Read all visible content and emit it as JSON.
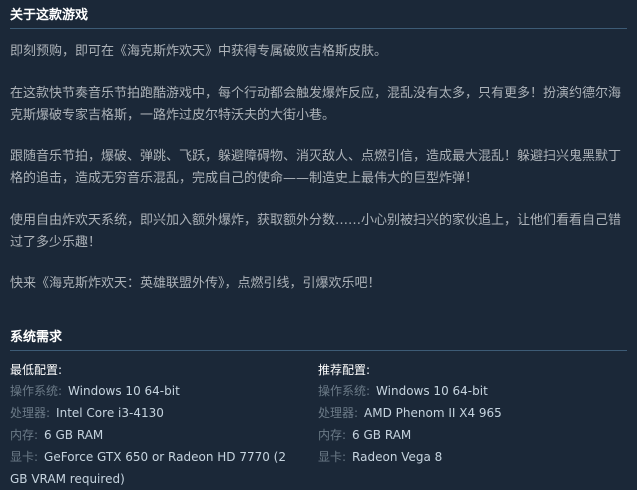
{
  "about": {
    "header": "关于这款游戏",
    "paragraphs": [
      "即刻预购，即可在《海克斯炸欢天》中获得专属破败吉格斯皮肤。",
      "在这款快节奏音乐节拍跑酷游戏中，每个行动都会触发爆炸反应，混乱没有太多，只有更多！扮演约德尔海克斯爆破专家吉格斯，一路炸过皮尔特沃夫的大街小巷。",
      "跟随音乐节拍，爆破、弹跳、飞跃，躲避障碍物、消灭敌人、点燃引信，造成最大混乱！躲避扫兴鬼黑默丁格的追击，造成无穷音乐混乱，完成自己的使命——制造史上最伟大的巨型炸弹！",
      "使用自由炸欢天系统，即兴加入额外爆炸，获取额外分数……小心别被扫兴的家伙追上，让他们看看自己错过了多少乐趣！",
      "快来《海克斯炸欢天：英雄联盟外传》，点燃引线，引爆欢乐吧！"
    ]
  },
  "sysreq": {
    "header": "系统需求",
    "minimum": {
      "title": "最低配置:",
      "rows": [
        {
          "label": "操作系统:",
          "value": "Windows 10 64-bit"
        },
        {
          "label": "处理器:",
          "value": "Intel Core i3-4130"
        },
        {
          "label": "内存:",
          "value": "6 GB RAM"
        },
        {
          "label": "显卡:",
          "value": "GeForce GTX 650 or Radeon HD 7770 (2 GB VRAM required)"
        }
      ]
    },
    "recommended": {
      "title": "推荐配置:",
      "rows": [
        {
          "label": "操作系统:",
          "value": "Windows 10 64-bit"
        },
        {
          "label": "处理器:",
          "value": "AMD Phenom II X4 965"
        },
        {
          "label": "内存:",
          "value": "6 GB RAM"
        },
        {
          "label": "显卡:",
          "value": "Radeon Vega 8"
        }
      ]
    }
  }
}
